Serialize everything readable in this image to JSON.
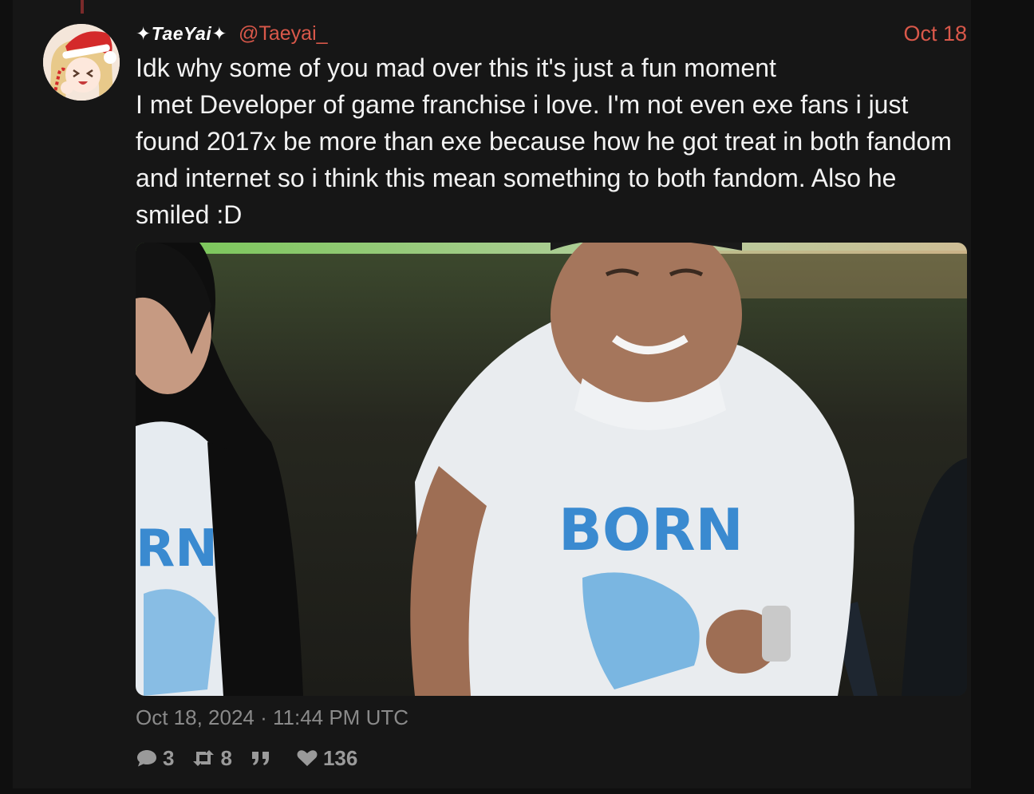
{
  "tweet": {
    "display_name": "✦TaeYai✦",
    "handle": "@Taeyai_",
    "date_short": "Oct 18",
    "text": "Idk why some of you mad over this it's just a fun moment\nI met Developer of game franchise i love. I'm not even exe fans i just found 2017x be more than exe because how he got treat in both fandom and internet so i think this mean something to both fandom. Also he smiled :D",
    "timestamp": "Oct 18, 2024 · 11:44 PM UTC",
    "media": {
      "shirt_text_center": "BORN",
      "shirt_text_left": "RN"
    },
    "stats": {
      "replies": "3",
      "retweets": "8",
      "quotes": "",
      "likes": "136"
    }
  },
  "icons": {
    "reply": "comment-icon",
    "retweet": "retweet-icon",
    "quote": "quote-icon",
    "like": "heart-icon"
  },
  "colors": {
    "accent": "#d9584a",
    "background": "#161616",
    "text": "#f2f2f2",
    "muted": "#8a8a8a"
  }
}
